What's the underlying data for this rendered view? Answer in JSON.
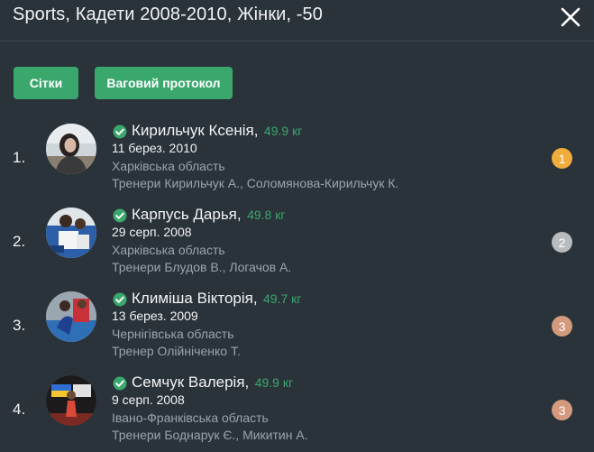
{
  "header": {
    "title": "Sports, Кадети 2008-2010, Жінки, -50",
    "close_icon": "close-icon"
  },
  "toolbar": {
    "grids_label": "Сітки",
    "weigh_label": "Ваговий протокол",
    "button_color": "#3aa76d"
  },
  "athletes": [
    {
      "rank": "1.",
      "name": "Кирильчук Ксенія,",
      "weight": "49.9 кг",
      "dob": "11 берез. 2010",
      "region": "Харківська область",
      "coaches": "Тренери Кирильчук А.,  Соломянова-Кирильчук К.",
      "place": "1",
      "medal_color": "#f0ad3c"
    },
    {
      "rank": "2.",
      "name": "Карпусь Дарья,",
      "weight": "49.8 кг",
      "dob": "29 серп. 2008",
      "region": "Харківська область",
      "coaches": "Тренери Блудов В.,  Логачов А.",
      "place": "2",
      "medal_color": "#b9bcbe"
    },
    {
      "rank": "3.",
      "name": "Климіша Вікторія,",
      "weight": "49.7 кг",
      "dob": "13 берез. 2009",
      "region": "Чернігівська область",
      "coaches": "Тренер Олійніченко Т.",
      "place": "3",
      "medal_color": "#d49a7e"
    },
    {
      "rank": "4.",
      "name": "Семчук Валерія,",
      "weight": "49.9 кг",
      "dob": "9 серп. 2008",
      "region": "Івано-Франківська область",
      "coaches": "Тренери Боднарук Є.,  Микитин А.",
      "place": "3",
      "medal_color": "#d49a7e"
    }
  ]
}
